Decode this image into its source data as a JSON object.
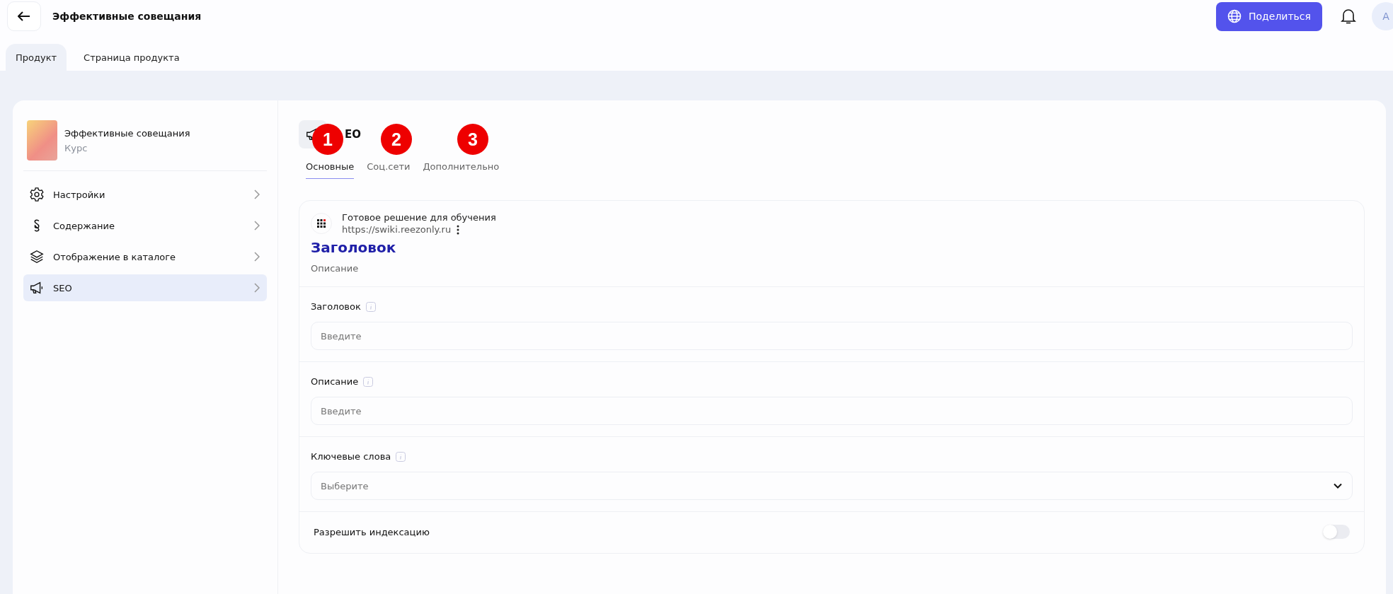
{
  "header": {
    "title": "Эффективные совещания",
    "share_button": "Поделиться",
    "avatar": "A"
  },
  "tabs": [
    {
      "label": "Продукт",
      "selected": true
    },
    {
      "label": "Страница продукта",
      "selected": false
    }
  ],
  "product": {
    "name": "Эффективные совещания",
    "type": "Курс"
  },
  "sidebar": {
    "items": [
      {
        "label": "Настройки",
        "selected": false
      },
      {
        "label": "Содержание",
        "selected": false
      },
      {
        "label": "Отображение в каталоге",
        "selected": false
      },
      {
        "label": "SEO",
        "selected": true
      }
    ]
  },
  "section": {
    "title": "EO",
    "subtabs": [
      {
        "label": "Основные",
        "selected": true
      },
      {
        "label": "Соц.сети",
        "selected": false
      },
      {
        "label": "Дополнительно",
        "selected": false
      }
    ]
  },
  "annotations": [
    "1",
    "2",
    "3"
  ],
  "preview": {
    "site_name": "Готовое решение для обучения",
    "url": "https://swiki.reezonly.ru",
    "title": "Заголовок",
    "description": "Описание"
  },
  "fields": [
    {
      "kind": "input",
      "label": "Заголовок",
      "placeholder": "Введите"
    },
    {
      "kind": "input",
      "label": "Описание",
      "placeholder": "Введите"
    },
    {
      "kind": "select",
      "label": "Ключевые слова",
      "placeholder": "Выберите"
    }
  ],
  "indexing": {
    "label": "Разрешить индексацию",
    "on": false
  }
}
